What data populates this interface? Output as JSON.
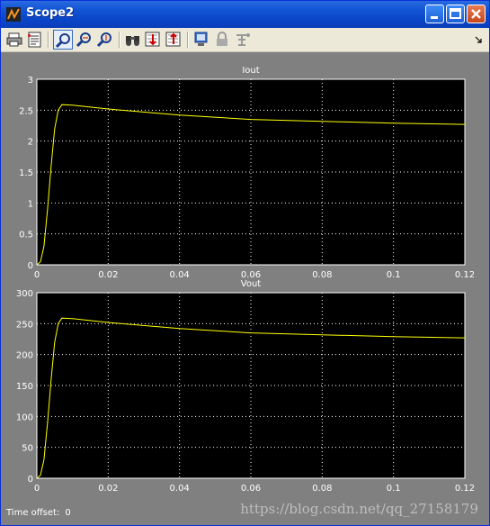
{
  "window": {
    "title": "Scope2"
  },
  "toolbar": {
    "buttons": [
      {
        "name": "print-icon"
      },
      {
        "name": "parameters-icon"
      },
      {
        "name": "zoom-icon"
      },
      {
        "name": "zoom-x-icon"
      },
      {
        "name": "zoom-y-icon"
      },
      {
        "name": "autoscale-icon"
      },
      {
        "name": "save-axes-icon"
      },
      {
        "name": "restore-axes-icon"
      },
      {
        "name": "floating-scope-icon"
      },
      {
        "name": "lock-axes-icon"
      },
      {
        "name": "signal-selector-icon"
      }
    ]
  },
  "status": {
    "offset_label": "Time offset:",
    "offset_value": "0"
  },
  "watermark": "https://blog.csdn.net/qq_27158179",
  "chart_data": [
    {
      "type": "line",
      "title": "Iout",
      "xlim": [
        0,
        0.12
      ],
      "ylim": [
        0,
        3
      ],
      "x_ticks": [
        "0",
        "0.02",
        "0.04",
        "0.06",
        "0.08",
        "0.1",
        "0.12"
      ],
      "y_ticks": [
        "0",
        "0.5",
        "1",
        "1.5",
        "2",
        "2.5",
        "3"
      ],
      "grid": true,
      "series": [
        {
          "color": "#ffff00",
          "x": [
            0,
            0.001,
            0.002,
            0.003,
            0.004,
            0.005,
            0.006,
            0.007,
            0.01,
            0.02,
            0.04,
            0.06,
            0.08,
            0.1,
            0.12
          ],
          "y": [
            0,
            0.05,
            0.3,
            0.9,
            1.6,
            2.2,
            2.5,
            2.59,
            2.58,
            2.52,
            2.42,
            2.35,
            2.32,
            2.29,
            2.27
          ]
        }
      ]
    },
    {
      "type": "line",
      "title": "Vout",
      "xlim": [
        0,
        0.12
      ],
      "ylim": [
        0,
        300
      ],
      "x_ticks": [
        "0",
        "0.02",
        "0.04",
        "0.06",
        "0.08",
        "0.1",
        "0.12"
      ],
      "y_ticks": [
        "0",
        "50",
        "100",
        "150",
        "200",
        "250",
        "300"
      ],
      "grid": true,
      "series": [
        {
          "color": "#ffff00",
          "x": [
            0,
            0.001,
            0.002,
            0.003,
            0.004,
            0.005,
            0.006,
            0.007,
            0.01,
            0.02,
            0.04,
            0.06,
            0.08,
            0.1,
            0.12
          ],
          "y": [
            0,
            5,
            30,
            90,
            160,
            220,
            250,
            259,
            258,
            252,
            242,
            235,
            232,
            229,
            227
          ]
        }
      ]
    }
  ]
}
